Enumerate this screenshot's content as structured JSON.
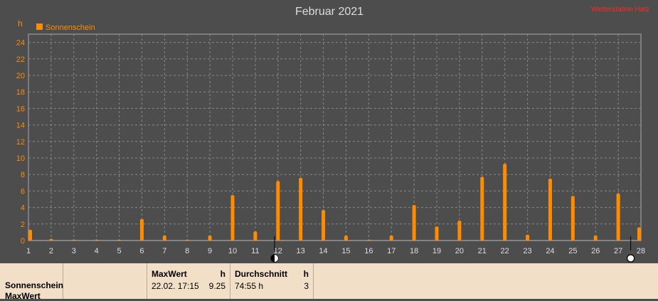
{
  "chart_data": {
    "type": "bar",
    "title": "Februar 2021",
    "ylabel": "h",
    "ylim": [
      0,
      25
    ],
    "yticks": [
      0,
      2,
      4,
      6,
      8,
      10,
      12,
      14,
      16,
      18,
      20,
      22,
      24
    ],
    "grid": true,
    "legend_position": "top-left",
    "series": [
      {
        "name": "Sonnenschein",
        "color": "#ff8c00",
        "x": [
          1,
          2,
          3,
          4,
          5,
          6,
          7,
          8,
          9,
          10,
          11,
          12,
          13,
          14,
          15,
          16,
          17,
          18,
          19,
          20,
          21,
          22,
          23,
          24,
          25,
          26,
          27,
          28
        ],
        "values": [
          1.3,
          0.2,
          0.1,
          0.1,
          0.1,
          2.6,
          0.6,
          0.1,
          0.6,
          5.5,
          1.1,
          7.2,
          7.6,
          3.7,
          0.6,
          0.1,
          0.6,
          4.3,
          1.7,
          2.4,
          7.7,
          9.3,
          0.7,
          7.5,
          5.4,
          0.6,
          5.7,
          1.6
        ]
      }
    ],
    "xticks": [
      1,
      2,
      3,
      4,
      5,
      6,
      7,
      8,
      9,
      10,
      11,
      12,
      13,
      14,
      15,
      16,
      17,
      18,
      19,
      20,
      21,
      22,
      23,
      24,
      25,
      26,
      27,
      28
    ],
    "moon_phase_markers": [
      {
        "day": 11.85,
        "symbol": "half-moon"
      },
      {
        "day": 27.55,
        "symbol": "full-moon"
      }
    ]
  },
  "watermark": "Wetterstation Hatz",
  "colors": {
    "background": "#4d4d4d",
    "plot_border": "#8c8c8c",
    "grid": "#888888",
    "axis_text": "#ff8c00",
    "title_text": "#dddddd",
    "watermark": "#ff2a1a",
    "panel": "#f2dfc8"
  },
  "summary": {
    "series_label": "Sonnenschein",
    "series_label2": "MaxWert",
    "max": {
      "header": "MaxWert",
      "unit": "h",
      "timestamp": "22.02.  17:15",
      "value": "9.25"
    },
    "avg": {
      "header": "Durchschnitt",
      "unit": "h",
      "total": "74:55 h",
      "value": "3"
    }
  }
}
